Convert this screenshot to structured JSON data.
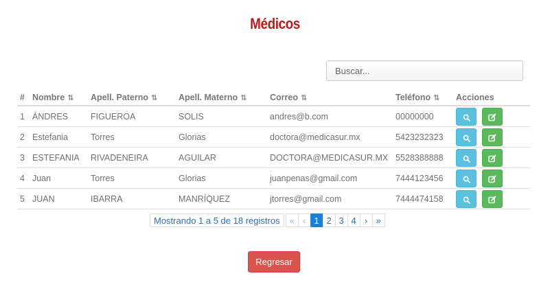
{
  "page": {
    "title": "Médicos"
  },
  "search": {
    "placeholder": "Buscar..."
  },
  "table": {
    "headers": {
      "num": "#",
      "nombre": "Nombre",
      "paterno": "Apell. Paterno",
      "materno": "Apell. Materno",
      "correo": "Correo",
      "telefono": "Teléfono",
      "acciones": "Acciones"
    },
    "sort_icon": "⇅",
    "rows": [
      {
        "num": "1",
        "nombre": "ÁNDRES",
        "paterno": "FIGUEROA",
        "materno": "SOLIS",
        "correo": "andres@b.com",
        "telefono": "00000000"
      },
      {
        "num": "2",
        "nombre": "Estefania",
        "paterno": "Torres",
        "materno": "Glorias",
        "correo": "doctora@medicasur.mx",
        "telefono": "5423232323"
      },
      {
        "num": "3",
        "nombre": "ESTEFANIA",
        "paterno": "RIVADENEIRA",
        "materno": "AGUILAR",
        "correo": "DOCTORA@MEDICASUR.MX",
        "telefono": "5528388888"
      },
      {
        "num": "4",
        "nombre": "Juan",
        "paterno": "Torres",
        "materno": "Glorias",
        "correo": "juanpenas@gmail.com",
        "telefono": "7444123456"
      },
      {
        "num": "5",
        "nombre": "JUAN",
        "paterno": "IBARRA",
        "materno": "MANRÍQUEZ",
        "correo": "jtorres@gmail.com",
        "telefono": "7444474158"
      }
    ],
    "action_icons": [
      "search-icon",
      "edit-icon"
    ]
  },
  "pagination": {
    "info": "Mostrando 1 a 5 de 18 registros",
    "first": "«",
    "prev": "‹",
    "pages": [
      "1",
      "2",
      "3",
      "4"
    ],
    "active_page": "1",
    "next": "›",
    "last": "»"
  },
  "footer": {
    "back_label": "Regresar"
  },
  "colors": {
    "title": "#b81c1c",
    "info_button": "#5bc0de",
    "success_button": "#5cb85c",
    "danger_button": "#d9534f",
    "active_page": "#1a7fd6"
  }
}
